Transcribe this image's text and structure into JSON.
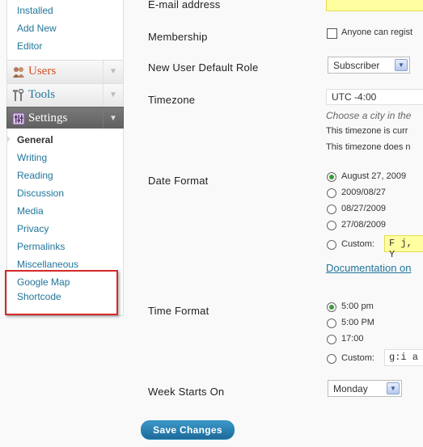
{
  "sidebar": {
    "appearance_sub": [
      "Installed",
      "Add New",
      "Editor"
    ],
    "menus": {
      "users": "Users",
      "tools": "Tools",
      "settings": "Settings"
    },
    "settings_sub": {
      "general": "General",
      "writing": "Writing",
      "reading": "Reading",
      "discussion": "Discussion",
      "media": "Media",
      "privacy": "Privacy",
      "permalinks": "Permalinks",
      "miscellaneous": "Miscellaneous",
      "google_map_line1": "Google Map",
      "google_map_line2": "Shortcode"
    }
  },
  "form": {
    "email_label": "E-mail address",
    "membership_label": "Membership",
    "membership_checkbox": "Anyone can regist",
    "default_role_label": "New User Default Role",
    "default_role_value": "Subscriber",
    "timezone_label": "Timezone",
    "timezone_value": "UTC -4:00",
    "timezone_hint": "Choose a city in the",
    "timezone_note1": "This timezone is curr",
    "timezone_note2": "This timezone does n",
    "date_format_label": "Date Format",
    "date_options": [
      "August 27, 2009",
      "2009/08/27",
      "08/27/2009",
      "27/08/2009"
    ],
    "date_custom_label": "Custom:",
    "date_custom_value": "F j, Y",
    "documentation_link": "Documentation on",
    "time_format_label": "Time Format",
    "time_options": [
      "5:00 pm",
      "5:00 PM",
      "17:00"
    ],
    "time_custom_label": "Custom:",
    "time_custom_value": "g:i a",
    "week_starts_label": "Week Starts On",
    "week_starts_value": "Monday",
    "save_button": "Save Changes"
  },
  "colors": {
    "link": "#21759b",
    "users_label": "#d54e21",
    "highlight_box": "#d42a2a",
    "save_button": "#2a7fb0",
    "required_yellow": "#ffffa0"
  }
}
